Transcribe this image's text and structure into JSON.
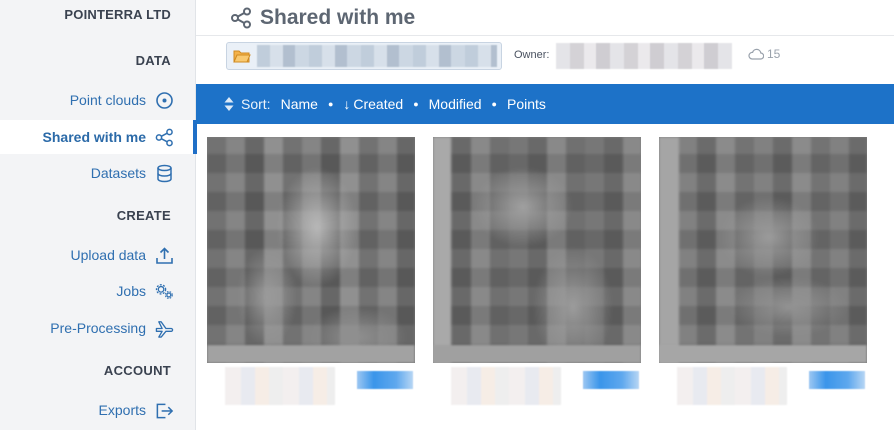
{
  "org_name": "POINTERRA LTD",
  "sidebar": {
    "sections": [
      {
        "title": "DATA",
        "items": [
          {
            "label": "Point clouds",
            "icon": "target-icon"
          },
          {
            "label": "Shared with me",
            "icon": "share-icon",
            "active": true
          },
          {
            "label": "Datasets",
            "icon": "database-icon"
          }
        ]
      },
      {
        "title": "CREATE",
        "items": [
          {
            "label": "Upload data",
            "icon": "upload-icon"
          },
          {
            "label": "Jobs",
            "icon": "gears-icon"
          },
          {
            "label": "Pre-Processing",
            "icon": "plane-icon"
          }
        ]
      },
      {
        "title": "ACCOUNT",
        "items": [
          {
            "label": "Exports",
            "icon": "export-icon"
          }
        ]
      }
    ]
  },
  "header": {
    "title": "Shared with me",
    "icon": "share-icon"
  },
  "info": {
    "owner_label": "Owner:",
    "point_count": "15",
    "cloud_icon": "cloud-icon"
  },
  "sortbar": {
    "label": "Sort:",
    "options": [
      "Name",
      "Created",
      "Modified",
      "Points"
    ],
    "active_option": "Created",
    "active_direction": "descending"
  },
  "colors": {
    "accent": "#1d72c8",
    "link": "#2f6fb0",
    "sidebar_bg": "#f3f4f6"
  }
}
